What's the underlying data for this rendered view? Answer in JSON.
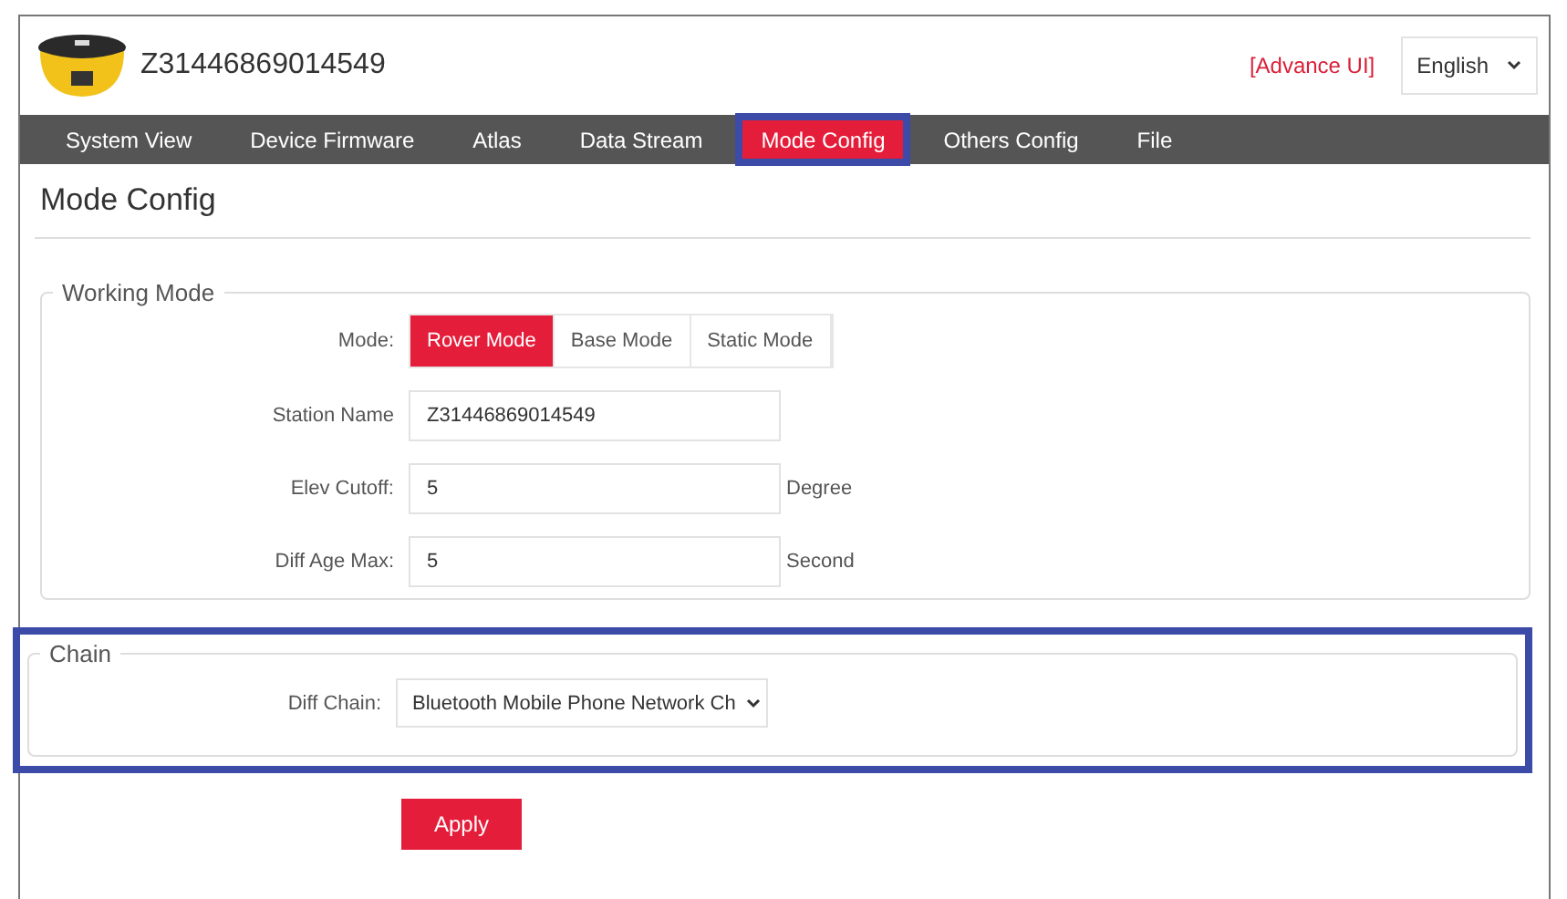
{
  "header": {
    "device_id": "Z31446869014549",
    "advance_link": "[Advance UI]",
    "language": "English"
  },
  "nav": [
    {
      "label": "System View",
      "selected": false,
      "highlighted": false
    },
    {
      "label": "Device Firmware",
      "selected": false,
      "highlighted": false
    },
    {
      "label": "Atlas",
      "selected": false,
      "highlighted": false
    },
    {
      "label": "Data Stream",
      "selected": false,
      "highlighted": false
    },
    {
      "label": "Mode Config",
      "selected": true,
      "highlighted": true
    },
    {
      "label": "Others Config",
      "selected": false,
      "highlighted": false
    },
    {
      "label": "File",
      "selected": false,
      "highlighted": false
    }
  ],
  "page_title": "Mode Config",
  "working_mode": {
    "legend": "Working Mode",
    "mode_label": "Mode:",
    "modes": [
      {
        "label": "Rover Mode",
        "selected": true
      },
      {
        "label": "Base Mode",
        "selected": false
      },
      {
        "label": "Static Mode",
        "selected": false
      }
    ],
    "fields": [
      {
        "label": "Station Name",
        "value": "Z31446869014549"
      },
      {
        "label": "Elev Cutoff:",
        "value": "5",
        "unit": "Degree"
      },
      {
        "label": "Diff Age Max:",
        "value": "5",
        "unit": "Second"
      }
    ]
  },
  "chain": {
    "legend": "Chain",
    "highlighted": true,
    "label": "Diff Chain:",
    "value": "Bluetooth Mobile Phone Network Ch"
  },
  "apply_button": "Apply"
}
